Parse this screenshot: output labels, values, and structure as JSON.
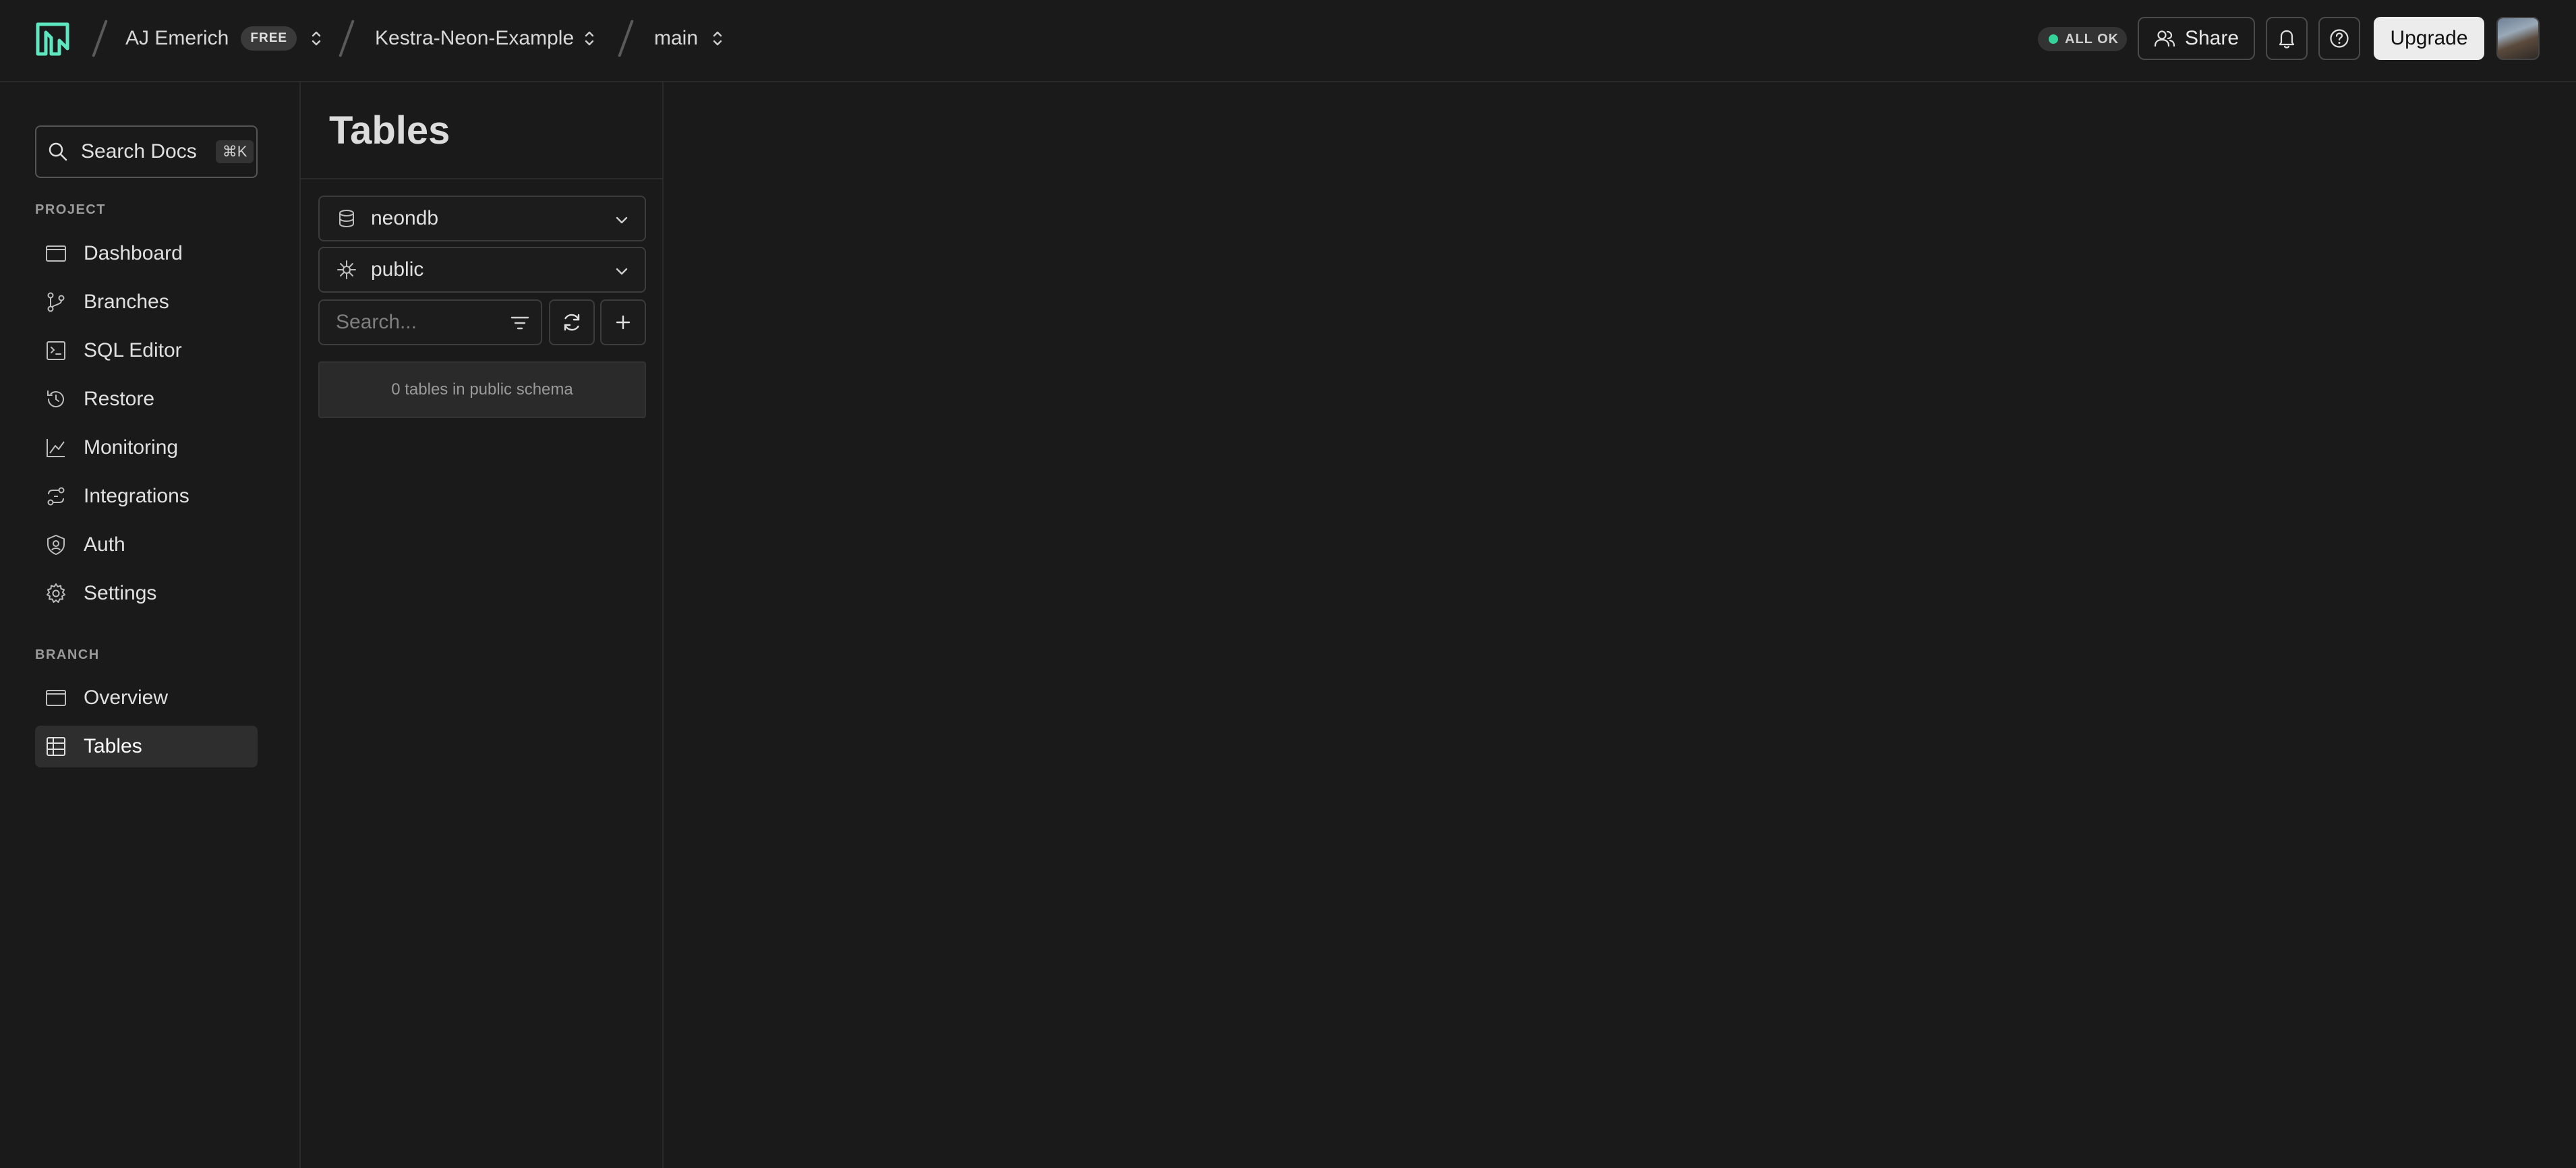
{
  "topbar": {
    "org_name": "AJ Emerich",
    "plan_badge": "FREE",
    "project_name": "Kestra-Neon-Example",
    "branch_name": "main",
    "status_text": "ALL OK",
    "status_color": "#34d399",
    "share_label": "Share",
    "upgrade_label": "Upgrade",
    "icons": [
      "neon-logo-icon",
      "users-icon",
      "bell-icon",
      "help-icon"
    ]
  },
  "sidebar": {
    "search_label": "Search Docs",
    "search_shortcut": "⌘K",
    "project_section": "PROJECT",
    "project_items": [
      {
        "label": "Dashboard",
        "icon": "dashboard-icon"
      },
      {
        "label": "Branches",
        "icon": "branches-icon"
      },
      {
        "label": "SQL Editor",
        "icon": "sql-editor-icon"
      },
      {
        "label": "Restore",
        "icon": "restore-icon"
      },
      {
        "label": "Monitoring",
        "icon": "monitoring-icon"
      },
      {
        "label": "Integrations",
        "icon": "integrations-icon"
      },
      {
        "label": "Auth",
        "icon": "auth-icon"
      },
      {
        "label": "Settings",
        "icon": "gear-icon"
      }
    ],
    "branch_section": "BRANCH",
    "branch_items": [
      {
        "label": "Overview",
        "icon": "overview-icon"
      },
      {
        "label": "Tables",
        "icon": "tables-icon",
        "active": true
      }
    ]
  },
  "tables_panel": {
    "title": "Tables",
    "database_select": "neondb",
    "schema_select": "public",
    "search_placeholder": "Search...",
    "empty_message": "0 tables in public schema"
  }
}
